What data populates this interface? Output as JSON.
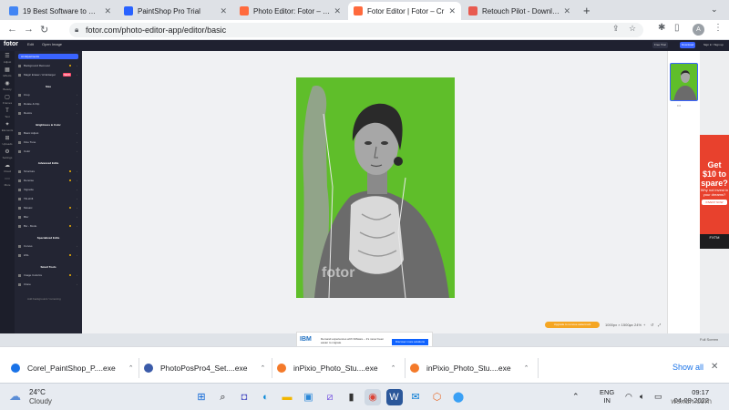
{
  "browser": {
    "tabs": [
      {
        "title": "19 Best Software to Restore",
        "favicon_color": "#4285f4",
        "active": false
      },
      {
        "title": "PaintShop Pro Trial",
        "favicon_color": "#2962ff",
        "active": false
      },
      {
        "title": "Photo Editor: Fotor – Free",
        "favicon_color": "#ff6a3d",
        "active": false
      },
      {
        "title": "Fotor Editor | Fotor – Cr",
        "favicon_color": "#ff6a3d",
        "active": true
      },
      {
        "title": "Retouch Pilot - Download",
        "favicon_color": "#e85a4f",
        "active": false
      }
    ],
    "new_tab": "+",
    "url": "fotor.com/photo-editor-app/editor/basic",
    "avatar_letter": "A"
  },
  "fotor": {
    "logo": "fotor",
    "top_controls": [
      "Edit",
      "Open Image"
    ],
    "top_right": [
      "Free Trial",
      "Download",
      "Sign in / Sign up"
    ],
    "rail": [
      {
        "icon": "☰",
        "label": "Adjust"
      },
      {
        "icon": "▦",
        "label": "Effects"
      },
      {
        "icon": "◉",
        "label": "Beauty"
      },
      {
        "icon": "▢",
        "label": "Frames"
      },
      {
        "icon": "T",
        "label": "Text"
      },
      {
        "icon": "✦",
        "label": "Elements"
      },
      {
        "icon": "⊞",
        "label": "Uploads"
      },
      {
        "icon": "⚙",
        "label": "Settings"
      },
      {
        "icon": "☁",
        "label": "Cloud"
      },
      {
        "icon": "⋯",
        "label": "More"
      }
    ],
    "panel": {
      "search": "AI Adjustments",
      "items": [
        {
          "label": "Background Remover",
          "type": "row",
          "dot": true
        },
        {
          "label": "Magic Eraser / AI Enlarger",
          "type": "row",
          "badge": "NEW"
        },
        {
          "label": "Size",
          "type": "heading"
        },
        {
          "label": "Crop",
          "type": "row"
        },
        {
          "label": "Rotate & Flip",
          "type": "row"
        },
        {
          "label": "Resize",
          "type": "row"
        },
        {
          "label": "Brightness & Color",
          "type": "heading"
        },
        {
          "label": "Basic Adjust",
          "type": "row"
        },
        {
          "label": "Fine Tune",
          "type": "row"
        },
        {
          "label": "Color",
          "type": "row"
        },
        {
          "label": "Advanced Edits",
          "type": "heading"
        },
        {
          "label": "Structure",
          "type": "row",
          "dot": true
        },
        {
          "label": "Denoise",
          "type": "row",
          "dot": true
        },
        {
          "label": "Vignette",
          "type": "row"
        },
        {
          "label": "Tilt-shift",
          "type": "row"
        },
        {
          "label": "Mosaic",
          "type": "row",
          "dot": true
        },
        {
          "label": "Blur",
          "type": "row"
        },
        {
          "label": "Bw - Mode",
          "type": "row",
          "dot": true
        },
        {
          "label": "Specialized Edits",
          "type": "heading"
        },
        {
          "label": "Curves",
          "type": "row"
        },
        {
          "label": "HSL",
          "type": "row",
          "dot": true
        },
        {
          "label": "Smart Tools",
          "type": "heading"
        },
        {
          "label": "Image Colorize",
          "type": "row",
          "dot": true
        },
        {
          "label": "Clone",
          "type": "row"
        }
      ],
      "footer": "Add background / removing"
    },
    "canvas": {
      "background_color": "#5fbe2a",
      "watermark": "fotor",
      "orange_pill": "Upgrade to remove watermark",
      "zoom_controls": [
        "1000px × 1500px",
        "–",
        "24%",
        "+",
        "↺",
        "⤢"
      ]
    },
    "right_panel": {
      "label": "Layers",
      "dots": "•••"
    },
    "ad": {
      "headline": "Get $10 to spare?",
      "sub": "Why not invest in your dreams?",
      "cta": "INVEST NOW",
      "brand": "FXTM"
    },
    "ibm_ad": {
      "logo": "IBM",
      "text": "Demand experiences with VMware – it's never been easier to migrate",
      "cta": "Discover more solutions"
    },
    "fullscreen": "Full Screen"
  },
  "downloads": [
    {
      "name": "Corel_PaintShop_P....exe",
      "color": "#1a73e8"
    },
    {
      "name": "PhotoPosPro4_Set....exe",
      "color": "#3b5ba9"
    },
    {
      "name": "inPixio_Photo_Stu....exe",
      "color": "#f47a2a"
    },
    {
      "name": "inPixio_Photo_Stu....exe",
      "color": "#f47a2a"
    }
  ],
  "shelf": {
    "show_all": "Show all",
    "close": "✕"
  },
  "taskbar": {
    "temperature": "24°C",
    "condition": "Cloudy",
    "icons": [
      {
        "name": "windows",
        "glyph": "⊞",
        "color": "#0a64d6",
        "bg": "transparent"
      },
      {
        "name": "search",
        "glyph": "⌕",
        "color": "#202124",
        "bg": "transparent"
      },
      {
        "name": "teams",
        "glyph": "◘",
        "color": "#5b5fc7",
        "bg": "transparent"
      },
      {
        "name": "edge",
        "glyph": "◐",
        "color": "#0c8ad8",
        "bg": "transparent"
      },
      {
        "name": "file-explorer",
        "glyph": "▬",
        "color": "#f2b600",
        "bg": "transparent"
      },
      {
        "name": "store",
        "glyph": "▣",
        "color": "#2b88d8",
        "bg": "transparent"
      },
      {
        "name": "photos",
        "glyph": "⧄",
        "color": "#6f4ae0",
        "bg": "transparent"
      },
      {
        "name": "terminal",
        "glyph": "▮",
        "color": "#333",
        "bg": "transparent"
      },
      {
        "name": "chrome",
        "glyph": "◉",
        "color": "#db4437",
        "bg": "#cfd8e3"
      },
      {
        "name": "word",
        "glyph": "W",
        "color": "#ffffff",
        "bg": "#2b579a"
      },
      {
        "name": "mail",
        "glyph": "✉",
        "color": "#0078d4",
        "bg": "transparent"
      },
      {
        "name": "office",
        "glyph": "⬡",
        "color": "#e86c2b",
        "bg": "transparent"
      },
      {
        "name": "maps",
        "glyph": "⬤",
        "color": "#3aa0f5",
        "bg": "transparent"
      }
    ],
    "lang": "ENG",
    "region": "IN",
    "time": "09:17",
    "date": "04-08-2022",
    "site": "wsxdn.com"
  }
}
